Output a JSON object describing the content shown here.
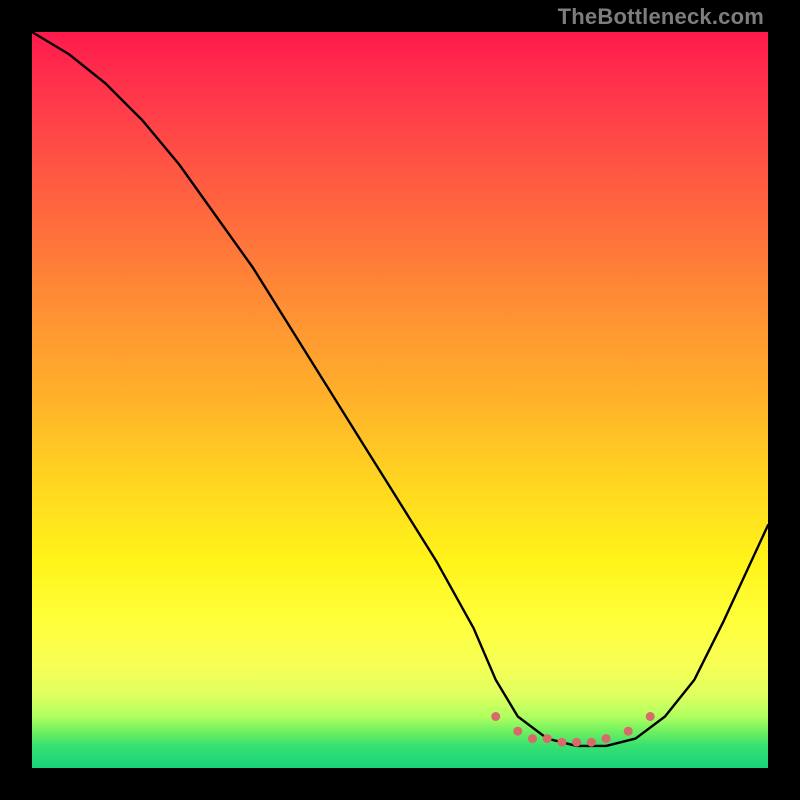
{
  "watermark": "TheBottleneck.com",
  "chart_data": {
    "type": "line",
    "title": "",
    "xlabel": "",
    "ylabel": "",
    "xlim": [
      0,
      100
    ],
    "ylim": [
      0,
      100
    ],
    "grid": false,
    "series": [
      {
        "name": "bottleneck-curve",
        "x": [
          0,
          5,
          10,
          15,
          20,
          25,
          30,
          35,
          40,
          45,
          50,
          55,
          60,
          63,
          66,
          70,
          74,
          78,
          82,
          86,
          90,
          94,
          100
        ],
        "values": [
          100,
          97,
          93,
          88,
          82,
          75,
          68,
          60,
          52,
          44,
          36,
          28,
          19,
          12,
          7,
          4,
          3,
          3,
          4,
          7,
          12,
          20,
          33
        ]
      }
    ],
    "markers": {
      "name": "flat-minimum-dots",
      "color": "#d86a6a",
      "x": [
        63,
        66,
        68,
        70,
        72,
        74,
        76,
        78,
        81,
        84
      ],
      "y": [
        7,
        5,
        4,
        4,
        3.5,
        3.5,
        3.5,
        4,
        5,
        7
      ]
    },
    "background_gradient": {
      "direction": "vertical",
      "stops": [
        {
          "pos": 0.0,
          "color": "#ff1a4d"
        },
        {
          "pos": 0.5,
          "color": "#ffb22a"
        },
        {
          "pos": 0.8,
          "color": "#ffff3a"
        },
        {
          "pos": 0.95,
          "color": "#70f060"
        },
        {
          "pos": 1.0,
          "color": "#18d078"
        }
      ]
    }
  }
}
